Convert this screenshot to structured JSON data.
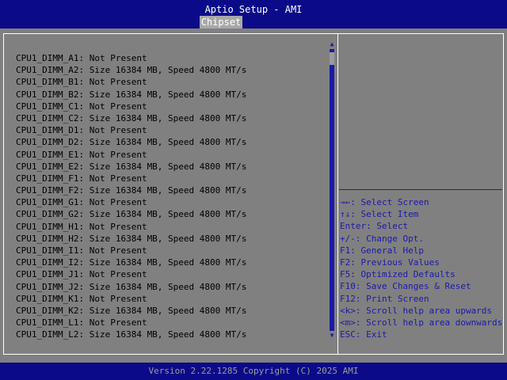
{
  "app": {
    "title": "Aptio Setup - AMI"
  },
  "tabs": [
    {
      "label": "Chipset"
    }
  ],
  "dimm_list": [
    "CPU1_DIMM_A1: Not Present",
    "CPU1_DIMM_A2: Size 16384 MB, Speed 4800 MT/s",
    "CPU1_DIMM_B1: Not Present",
    "CPU1_DIMM_B2: Size 16384 MB, Speed 4800 MT/s",
    "CPU1_DIMM_C1: Not Present",
    "CPU1_DIMM_C2: Size 16384 MB, Speed 4800 MT/s",
    "CPU1_DIMM_D1: Not Present",
    "CPU1_DIMM_D2: Size 16384 MB, Speed 4800 MT/s",
    "CPU1_DIMM_E1: Not Present",
    "CPU1_DIMM_E2: Size 16384 MB, Speed 4800 MT/s",
    "CPU1_DIMM_F1: Not Present",
    "CPU1_DIMM_F2: Size 16384 MB, Speed 4800 MT/s",
    "CPU1_DIMM_G1: Not Present",
    "CPU1_DIMM_G2: Size 16384 MB, Speed 4800 MT/s",
    "CPU1_DIMM_H1: Not Present",
    "CPU1_DIMM_H2: Size 16384 MB, Speed 4800 MT/s",
    "CPU1_DIMM_I1: Not Present",
    "CPU1_DIMM_I2: Size 16384 MB, Speed 4800 MT/s",
    "CPU1_DIMM_J1: Not Present",
    "CPU1_DIMM_J2: Size 16384 MB, Speed 4800 MT/s",
    "CPU1_DIMM_K1: Not Present",
    "CPU1_DIMM_K2: Size 16384 MB, Speed 4800 MT/s",
    "CPU1_DIMM_L1: Not Present",
    "CPU1_DIMM_L2: Size 16384 MB, Speed 4800 MT/s"
  ],
  "help": [
    "→←: Select Screen",
    "↑↓: Select Item",
    "Enter: Select",
    "+/-: Change Opt.",
    "F1: General Help",
    "F2: Previous Values",
    "F5: Optimized Defaults",
    "F10: Save Changes & Reset",
    "F12: Print Screen",
    "<k>: Scroll help area upwards",
    "<m>: Scroll help area downwards",
    "ESC: Exit"
  ],
  "scrollbar": {
    "up_icon": "▲",
    "down_icon": "▼"
  },
  "footer": {
    "text": "Version 2.22.1285 Copyright (C) 2025 AMI"
  },
  "colors": {
    "header_bg": "#0b0b8a",
    "body_bg": "#808080",
    "accent_text": "#1a1aa8",
    "tab_bg": "#a8a8a8"
  }
}
